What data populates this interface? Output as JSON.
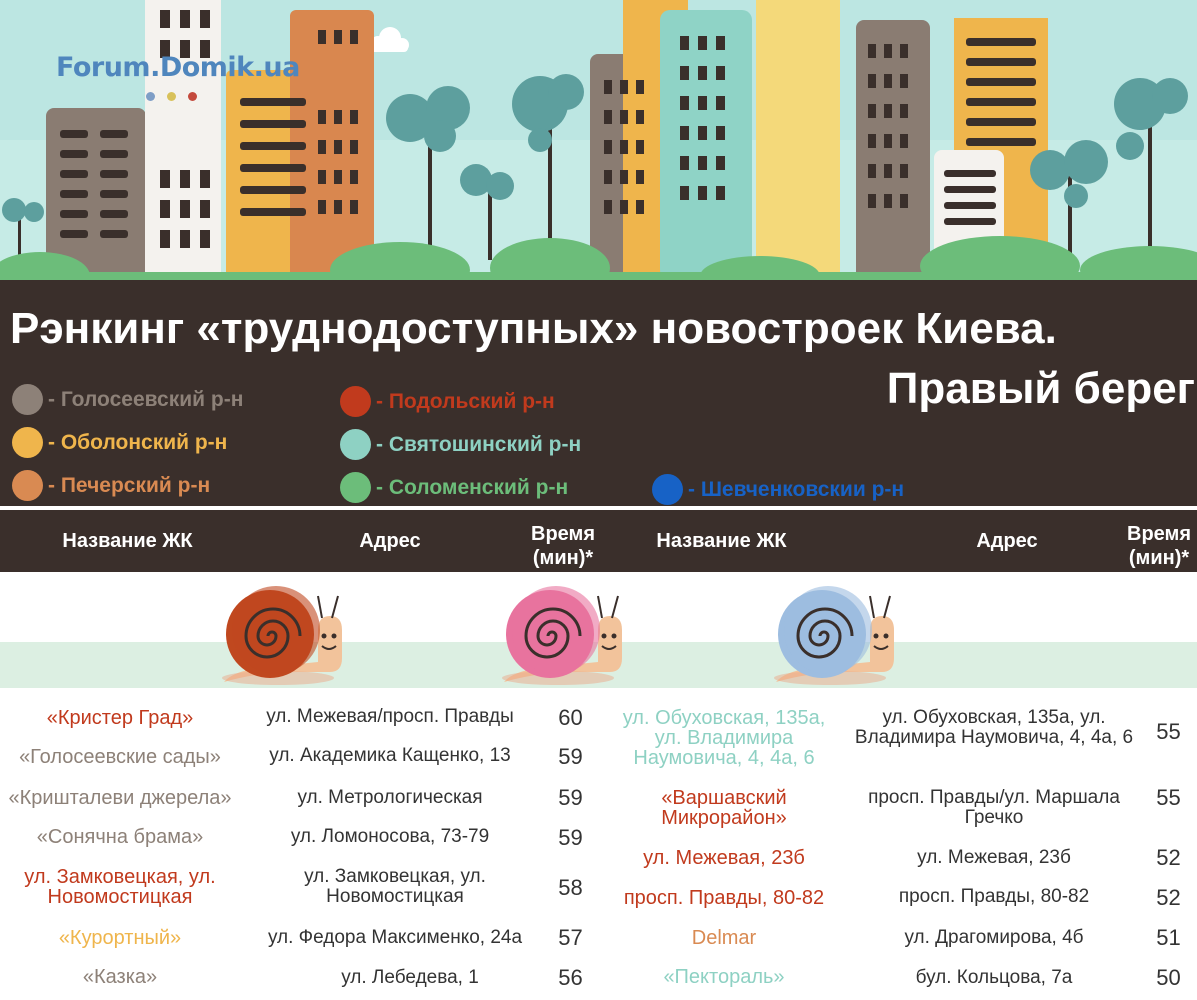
{
  "logo": {
    "text": "Forum.Domik.ua",
    "dot_colors": [
      "#7e9ec6",
      "#d8c15a",
      "#c44a3c"
    ]
  },
  "title": {
    "line1": "Рэнкинг «труднодоступных» новостроек Киева.",
    "line2": "Правый берег"
  },
  "legend": [
    {
      "label": "- Голосеевский р-н",
      "color": "#8d8178"
    },
    {
      "label": "- Оболонский р-н",
      "color": "#efb54c"
    },
    {
      "label": "- Печерский р-н",
      "color": "#d98a52"
    },
    {
      "label": "- Подольский р-н",
      "color": "#c13a1d"
    },
    {
      "label": "- Святошинский р-н",
      "color": "#8ed1c3"
    },
    {
      "label": "- Соломенский р-н",
      "color": "#6cbd7a"
    },
    {
      "label": "- Шевченковскии р-н",
      "color": "#1762c6"
    }
  ],
  "header": {
    "left": {
      "name": "Название ЖК",
      "address": "Адрес",
      "time": "Время (мин)*"
    },
    "right": {
      "name": "Название ЖК",
      "address": "Адрес",
      "time": "Время (мин)*"
    }
  },
  "snails": [
    {
      "icon": "snail-icon",
      "shell": "#c0481f"
    },
    {
      "icon": "snail-icon",
      "shell": "#e8739e"
    },
    {
      "icon": "snail-icon",
      "shell": "#9dbde0"
    }
  ],
  "left_rows": [
    {
      "name": "«Кристер Град»",
      "address": "ул. Межевая/просп. Правды",
      "time": "60",
      "color": "#c13a1d"
    },
    {
      "name": "«Голосеевские сады»",
      "address": "ул. Академика Кащенко, 13",
      "time": "59",
      "color": "#8d8178"
    },
    {
      "name": "«Кришталеви джерела»",
      "address": "ул. Метрологическая",
      "time": "59",
      "color": "#8d8178"
    },
    {
      "name": "«Сонячна брама»",
      "address": "ул. Ломоносова, 73-79",
      "time": "59",
      "color": "#8d8178"
    },
    {
      "name": "ул. Замковецкая, ул. Новомостицкая",
      "address": "ул. Замковецкая, ул. Новомостицкая",
      "time": "58",
      "color": "#c13a1d"
    },
    {
      "name": "«Курортный»",
      "address": "ул. Федора Максименко, 24а",
      "time": "57",
      "color": "#efb54c"
    },
    {
      "name": "«Казка»",
      "address": "ул. Лебедева, 1",
      "time": "56",
      "color": "#8d8178"
    }
  ],
  "right_rows": [
    {
      "name": "ул. Обуховская, 135а, ул. Владимира Наумовича, 4, 4а, 6",
      "address": "ул. Обуховская, 135а, ул. Владимира Наумовича, 4, 4а, 6",
      "time": "55",
      "color": "#8ed1c3"
    },
    {
      "name": "«Варшавский Микрорайон»",
      "address": "просп. Правды/ул. Маршала Гречко",
      "time": "55",
      "color": "#c13a1d"
    },
    {
      "name": "ул. Межевая, 23б",
      "address": "ул. Межевая, 23б",
      "time": "52",
      "color": "#c13a1d"
    },
    {
      "name": "просп. Правды, 80-82",
      "address": "просп. Правды, 80-82",
      "time": "52",
      "color": "#c13a1d"
    },
    {
      "name": "Delmar",
      "address": "ул. Драгомирова, 4б",
      "time": "51",
      "color": "#d98a52"
    },
    {
      "name": "«Пектораль»",
      "address": "бул. Кольцова, 7а",
      "time": "50",
      "color": "#8ed1c3"
    }
  ]
}
